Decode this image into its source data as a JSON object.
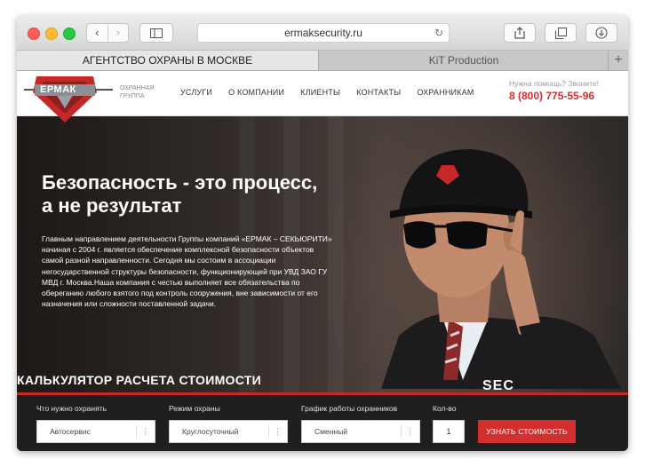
{
  "browser": {
    "address": "ermaksecurity.ru",
    "tabs": [
      {
        "label": "АГЕНТСТВО ОХРАНЫ В МОСКВЕ",
        "active": true
      },
      {
        "label": "KiT Production",
        "active": false
      }
    ],
    "icons": [
      "back-icon",
      "forward-icon",
      "sidebar-icon",
      "reload-icon",
      "share-icon",
      "tabs-icon",
      "download-icon",
      "add-tab-icon"
    ]
  },
  "site": {
    "logo_text": "ЕРМАК",
    "logo_subtitle": "ОХРАННАЯ ГРУППА",
    "menu": [
      "УСЛУГИ",
      "О КОМПАНИИ",
      "КЛИЕНТЫ",
      "КОНТАКТЫ",
      "ОХРАННИКАМ"
    ],
    "help_text": "Нужна помощь? Звоните!",
    "phone": "8 (800) 775-55-96",
    "accent": "#d32f2f"
  },
  "hero": {
    "title_line1": "Безопасность - это процесс,",
    "title_line2": "а не результат",
    "description": "Главным направлением деятельности Группы компаний «ЕРМАК – СЕКЬЮРИТИ» начиная с 2004 г. является обеспечение комплексной безопасности объектов самой разной направленности. Сегодня мы состоим в ассоциации негосударственной структуры безопасности, функционирующей при УВД ЗАО ГУ МВД г. Москва.Наша компания с честью выполняет все обязательства по обереганию любого взятого под контроль сооружения, вне зависимости от его назначения или сложности поставленной задачи.",
    "sec_text": "SEC"
  },
  "calculator": {
    "title": "КАЛЬКУЛЯТОР РАСЧЕТА СТОИМОСТИ",
    "fields": [
      {
        "label": "Что нужно охранять",
        "value": "Автосервис"
      },
      {
        "label": "Режим охраны",
        "value": "Круглосуточный"
      },
      {
        "label": "График работы охранников",
        "value": "Сменный"
      }
    ],
    "qty_label": "Кол-во",
    "qty_value": "1",
    "button": "УЗНАТЬ СТОИМОСТЬ"
  }
}
